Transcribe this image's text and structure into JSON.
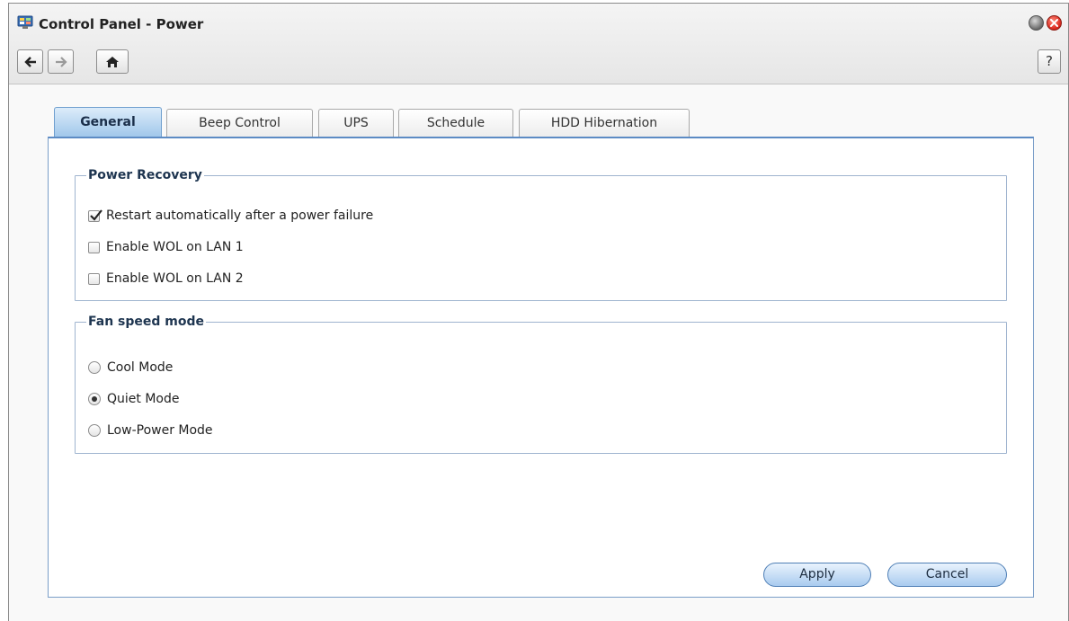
{
  "window": {
    "title": "Control Panel - Power",
    "icon": "control-panel-icon"
  },
  "toolbar": {
    "back_icon": "arrow-left-icon",
    "forward_icon": "arrow-right-icon",
    "home_icon": "home-icon",
    "help_label": "?"
  },
  "tabs": [
    {
      "label": "General",
      "active": true
    },
    {
      "label": "Beep Control",
      "active": false
    },
    {
      "label": "UPS",
      "active": false
    },
    {
      "label": "Schedule",
      "active": false
    },
    {
      "label": "HDD Hibernation",
      "active": false
    }
  ],
  "power_recovery": {
    "legend": "Power Recovery",
    "options": [
      {
        "label": "Restart automatically after a power failure",
        "checked": true
      },
      {
        "label": "Enable WOL on LAN 1",
        "checked": false
      },
      {
        "label": "Enable WOL on LAN 2",
        "checked": false
      }
    ]
  },
  "fan_speed": {
    "legend": "Fan speed mode",
    "options": [
      {
        "label": "Cool Mode",
        "selected": false
      },
      {
        "label": "Quiet Mode",
        "selected": true
      },
      {
        "label": "Low-Power Mode",
        "selected": false
      }
    ]
  },
  "actions": {
    "apply_label": "Apply",
    "cancel_label": "Cancel"
  },
  "colors": {
    "accent": "#5c8bc4",
    "tab_active": "#9fc6ea",
    "close_button": "#d9261c"
  }
}
